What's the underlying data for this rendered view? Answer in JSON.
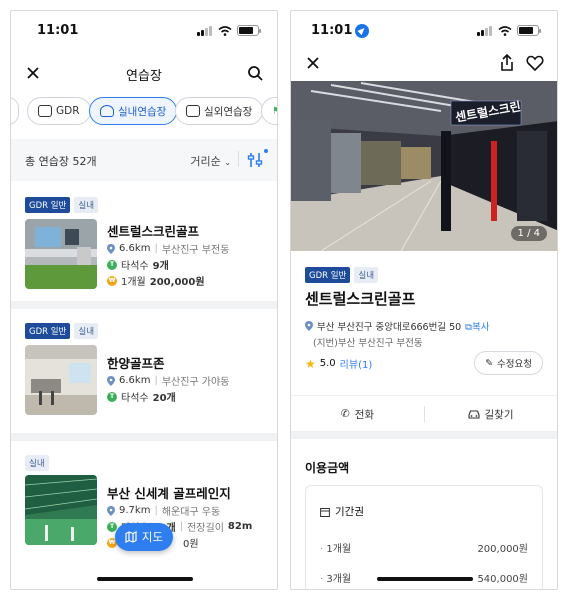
{
  "left": {
    "status_time": "11:01",
    "nav_title": "연습장",
    "chips": [
      {
        "label": "GDR",
        "active": false
      },
      {
        "label": "실내연습장",
        "active": true
      },
      {
        "label": "실외연습장",
        "active": false
      }
    ],
    "total": "총 연습장 52개",
    "sort": "거리순",
    "items": [
      {
        "badges": [
          "GDR 일반",
          "실내"
        ],
        "name": "센트럴스크린골프",
        "distance": "6.6km",
        "area": "부산진구 부전동",
        "tees": "타석수",
        "tees_count": "9개",
        "price_label": "1개월",
        "price": "200,000원"
      },
      {
        "badges": [
          "GDR 일반",
          "실내"
        ],
        "name": "한양골프존",
        "distance": "6.6km",
        "area": "부산진구 가야동",
        "tees": "타석수",
        "tees_count": "20개"
      },
      {
        "badges": [
          "실내"
        ],
        "name": "부산 신세계 골프레인지",
        "distance": "9.7km",
        "area": "해운대구 우동",
        "tees": "타석수",
        "tees_count": "60개",
        "length_label": "전장길이",
        "length": "82m",
        "price_tail": "0원"
      }
    ],
    "map_button": "지도"
  },
  "right": {
    "status_time": "11:01",
    "photo_counter": "1 / 4",
    "sign_text": "센트럴스크린",
    "badges": [
      "GDR 일반",
      "실내"
    ],
    "title": "센트럴스크린골프",
    "address": "부산 부산진구 중앙대로666번길 50",
    "copy": "복사",
    "jibun": "(지번)부산 부산진구 부전동",
    "rating": "5.0",
    "review": "리뷰(1)",
    "edit_button": "수정요청",
    "call": "전화",
    "directions": "길찾기",
    "section_title": "이용금액",
    "pass_title": "기간권",
    "prices": [
      {
        "label": "1개월",
        "value": "200,000원"
      },
      {
        "label": "3개월",
        "value": "540,000원"
      }
    ]
  },
  "colors": {
    "accent": "#2f7ef0",
    "badge_blue": "#1e4c9a",
    "star": "#f5b70a",
    "green": "#3fae5b",
    "orange": "#f2a516"
  }
}
